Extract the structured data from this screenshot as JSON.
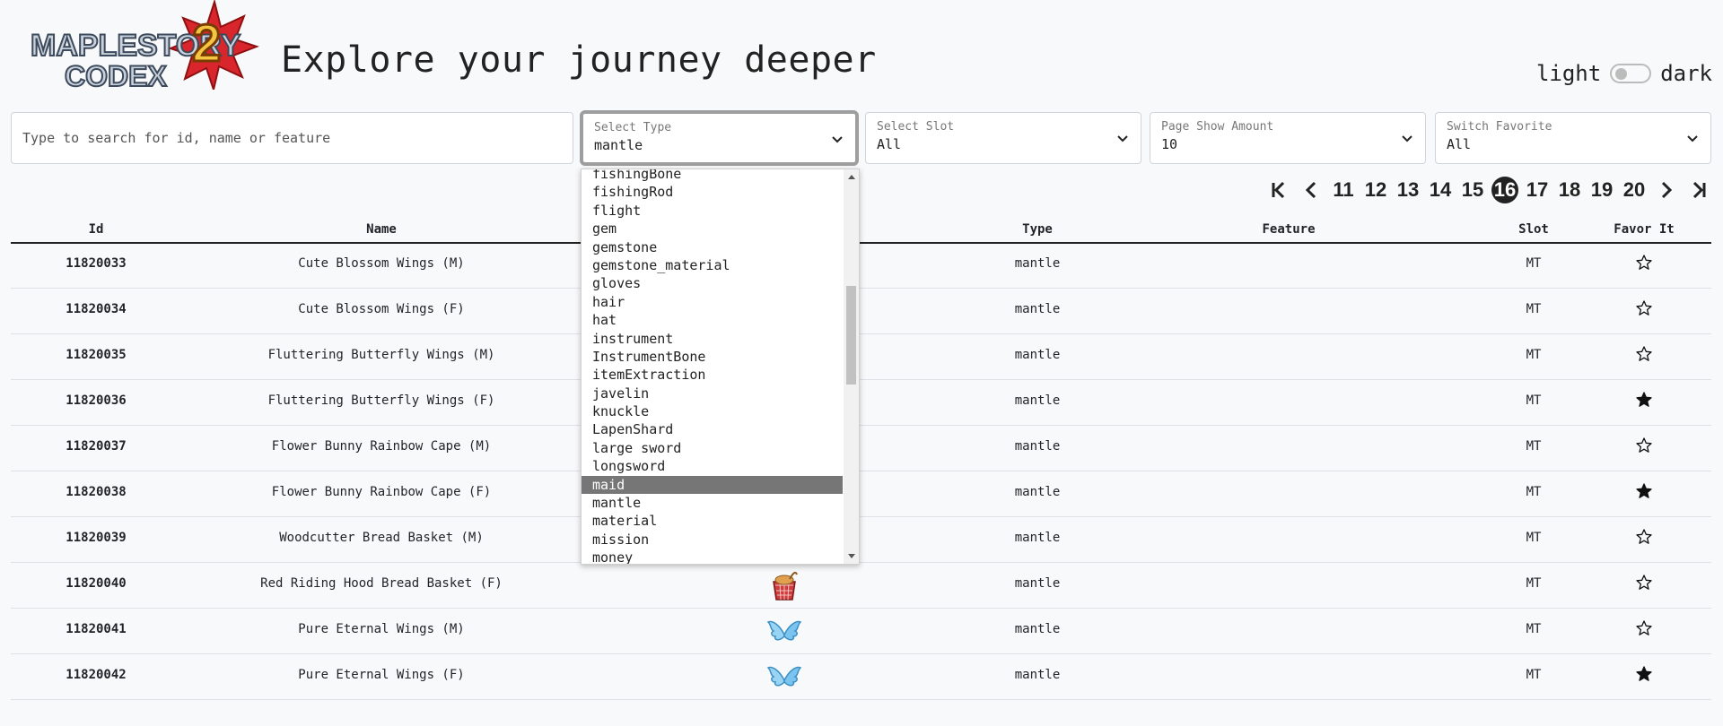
{
  "header": {
    "logo_line1": "MAPLESTORY",
    "logo_line2": "CODEX",
    "logo_number": "2",
    "headline": "Explore your journey deeper",
    "theme_light": "light",
    "theme_dark": "dark",
    "theme_is_dark": false
  },
  "filters": {
    "search_placeholder": "Type to search for id, name or feature",
    "type": {
      "label": "Select Type",
      "value": "mantle"
    },
    "slot": {
      "label": "Select Slot",
      "value": "All"
    },
    "amount": {
      "label": "Page Show Amount",
      "value": "10"
    },
    "favorite": {
      "label": "Switch Favorite",
      "value": "All"
    }
  },
  "type_dropdown": {
    "highlighted": "maid",
    "options": [
      "fishingBone",
      "fishingRod",
      "flight",
      "gem",
      "gemstone",
      "gemstone_material",
      "gloves",
      "hair",
      "hat",
      "instrument",
      "InstrumentBone",
      "itemExtraction",
      "javelin",
      "knuckle",
      "LapenShard",
      "large sword",
      "longsword",
      "maid",
      "mantle",
      "material",
      "mission",
      "money"
    ]
  },
  "pagination": {
    "pages": [
      "11",
      "12",
      "13",
      "14",
      "15",
      "16",
      "17",
      "18",
      "19",
      "20"
    ],
    "current": "16"
  },
  "table": {
    "columns": {
      "id": "Id",
      "name": "Name",
      "type": "Type",
      "feature": "Feature",
      "slot": "Slot",
      "favor": "Favor It"
    },
    "rows": [
      {
        "id": "11820033",
        "name": "Cute Blossom Wings (M)",
        "type": "mantle",
        "feature": "",
        "slot": "MT",
        "favorite": false,
        "icon": "wings-icon"
      },
      {
        "id": "11820034",
        "name": "Cute Blossom Wings (F)",
        "type": "mantle",
        "feature": "",
        "slot": "MT",
        "favorite": false,
        "icon": "wings-icon"
      },
      {
        "id": "11820035",
        "name": "Fluttering Butterfly Wings (M)",
        "type": "mantle",
        "feature": "",
        "slot": "MT",
        "favorite": false,
        "icon": "wings-icon"
      },
      {
        "id": "11820036",
        "name": "Fluttering Butterfly Wings (F)",
        "type": "mantle",
        "feature": "",
        "slot": "MT",
        "favorite": true,
        "icon": "wings-icon"
      },
      {
        "id": "11820037",
        "name": "Flower Bunny Rainbow Cape (M)",
        "type": "mantle",
        "feature": "",
        "slot": "MT",
        "favorite": false,
        "icon": "cape-icon"
      },
      {
        "id": "11820038",
        "name": "Flower Bunny Rainbow Cape (F)",
        "type": "mantle",
        "feature": "",
        "slot": "MT",
        "favorite": true,
        "icon": "cape-icon"
      },
      {
        "id": "11820039",
        "name": "Woodcutter Bread Basket (M)",
        "type": "mantle",
        "feature": "",
        "slot": "MT",
        "favorite": false,
        "icon": "basket-icon"
      },
      {
        "id": "11820040",
        "name": "Red Riding Hood Bread Basket (F)",
        "type": "mantle",
        "feature": "",
        "slot": "MT",
        "favorite": false,
        "icon": "basket-icon"
      },
      {
        "id": "11820041",
        "name": "Pure Eternal Wings (M)",
        "type": "mantle",
        "feature": "",
        "slot": "MT",
        "favorite": false,
        "icon": "wings-icon"
      },
      {
        "id": "11820042",
        "name": "Pure Eternal Wings (F)",
        "type": "mantle",
        "feature": "",
        "slot": "MT",
        "favorite": true,
        "icon": "wings-icon"
      }
    ]
  },
  "colors": {
    "background": "#f8f9fa",
    "text": "#212529",
    "highlight": "#767676",
    "logo_red": "#d9262c",
    "wing_blue": "#7cc4f0"
  }
}
